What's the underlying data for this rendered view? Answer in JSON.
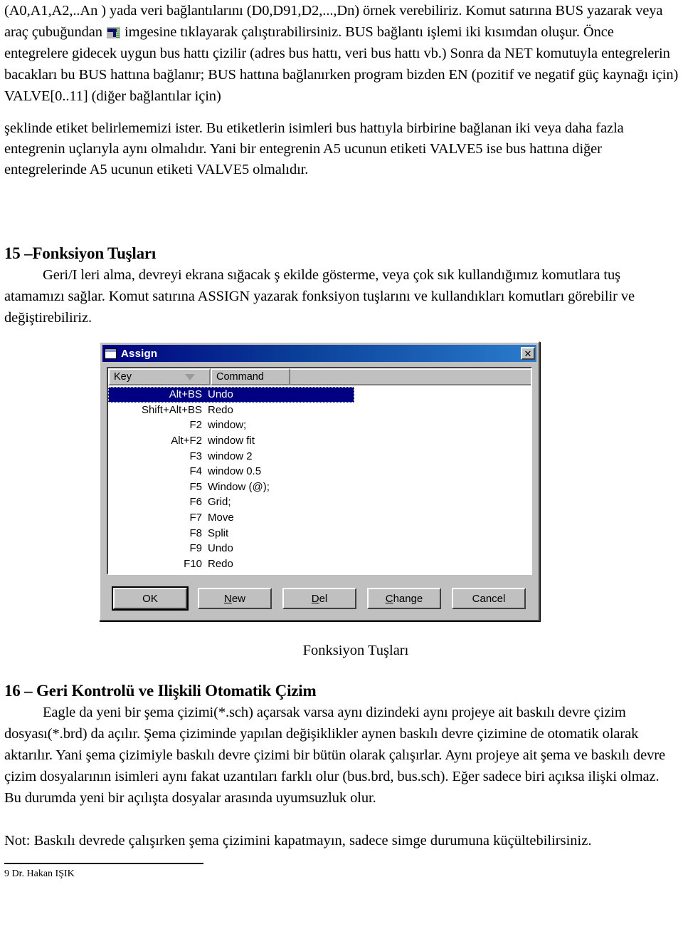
{
  "document": {
    "paragraphs": [
      {
        "id": "p1a",
        "text": "(A0,A1,A2,..An ) yada veri bağlantılarını (D0,D91,D2,...,Dn) örnek verebiliriz. Komut satırına BUS yazarak veya araç çubuğundan "
      },
      {
        "id": "p1b",
        "text": " imgesine tıklayarak çalıştırabilirsiniz. BUS bağlantı işlemi iki kısımdan oluşur. Önce entegrelere gidecek uygun bus hattı çizilir (adres bus hattı, veri bus hattı vb.) Sonra da NET komutuyla entegrelerin bacakları bu BUS hattına bağlanır; BUS hattına bağlanırken program bizden EN (pozitif ve negatif güç kaynağı için) VALVE[0..11] (diğer bağlantılar için)"
      },
      {
        "id": "p2",
        "text": "şeklinde etiket belirlememizi ister. Bu etiketlerin isimleri bus hattıyla birbirine bağlanan iki veya daha fazla entegrenin uçlarıyla aynı olmalıdır. Yani bir entegrenin A5 ucunun etiketi VALVE5 ise bus hattına diğer entegrelerinde A5 ucunun etiketi VALVE5 olmalıdır."
      }
    ],
    "section_15": {
      "heading": "15 –Fonksiyon Tuşları",
      "body": "Geri/I leri alma, devreyi ekrana sığacak  ş ekilde gösterme,  veya çok sık kullandığımız komutlara tuş  atamamızı sağlar. Komut satırına ASSIGN yazarak fonksiyon tuşlarını ve kullandıkları komutları görebilir ve değiştirebiliriz."
    },
    "figure_caption": "Fonksiyon Tuşları",
    "section_16": {
      "heading": "16 – Geri Kontrolü  ve Ilişkili Otomatik Çizim",
      "body": "Eagle da yeni bir şema çizimi(*.sch) açarsak varsa aynı dizindeki aynı projeye ait baskılı devre çizim dosyası(*.brd) da açılır.  Şema çiziminde yapılan değişiklikler aynen baskılı devre çizimine de otomatik olarak aktarılır. Yani şema çizimiyle baskılı devre çizimi bir bütün olarak çalışırlar. Aynı projeye ait şema ve baskılı devre çizim dosyalarının isimleri aynı fakat uzantıları farklı olur (bus.brd, bus.sch). Eğer sadece biri açıksa ilişki olmaz. Bu durumda yeni bir açılışta dosyalar arasında uyumsuzluk olur."
    },
    "note": "Not: Baskılı devrede çalışırken şema çizimini kapatmayın, sadece simge durumuna küçültebilirsiniz.",
    "footer": "9 Dr. Hakan IŞIK"
  },
  "dialog": {
    "title": "Assign",
    "window_icon": "window-icon",
    "close_label": "✕",
    "columns": {
      "key": "Key",
      "command": "Command",
      "sort_indicator": "sort-descending-triangle"
    },
    "rows": [
      {
        "key": "Alt+BS",
        "command": "Undo",
        "selected": true
      },
      {
        "key": "Shift+Alt+BS",
        "command": "Redo",
        "selected": false
      },
      {
        "key": "F2",
        "command": "window;",
        "selected": false
      },
      {
        "key": "Alt+F2",
        "command": "window fit",
        "selected": false
      },
      {
        "key": "F3",
        "command": "window 2",
        "selected": false
      },
      {
        "key": "F4",
        "command": "window 0.5",
        "selected": false
      },
      {
        "key": "F5",
        "command": "Window (@);",
        "selected": false
      },
      {
        "key": "F6",
        "command": "Grid;",
        "selected": false
      },
      {
        "key": "F7",
        "command": "Move",
        "selected": false
      },
      {
        "key": "F8",
        "command": "Split",
        "selected": false
      },
      {
        "key": "F9",
        "command": "Undo",
        "selected": false
      },
      {
        "key": "F10",
        "command": "Redo",
        "selected": false
      }
    ],
    "buttons": [
      {
        "label": "OK",
        "accel": "",
        "default": true
      },
      {
        "label": "New",
        "accel": "N",
        "default": false
      },
      {
        "label": "Del",
        "accel": "D",
        "default": false
      },
      {
        "label": "Change",
        "accel": "C",
        "default": false
      },
      {
        "label": "Cancel",
        "accel": "",
        "default": false
      }
    ],
    "colors": {
      "titlebar_left": "#000080",
      "titlebar_right": "#2a7ccd",
      "face": "#c0c0c0",
      "selection": "#000080"
    }
  }
}
